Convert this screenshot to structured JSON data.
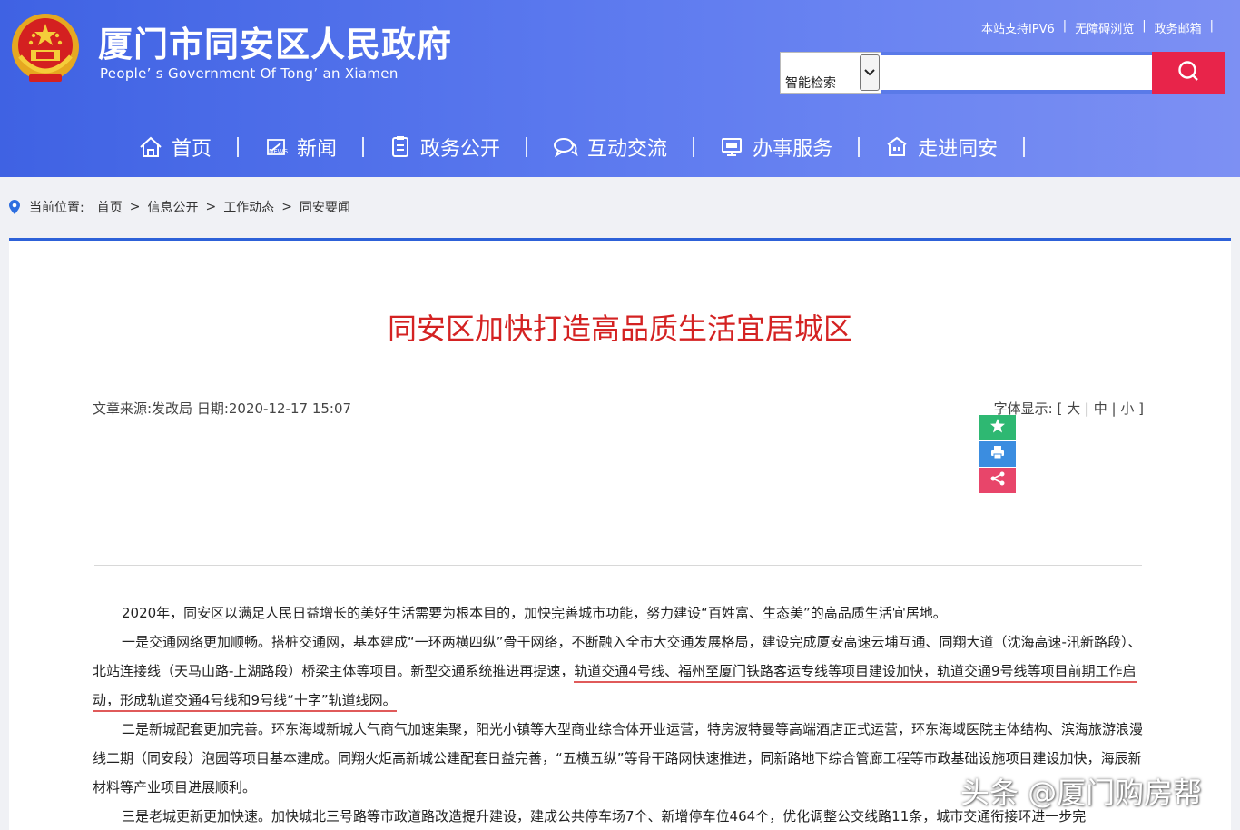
{
  "header": {
    "title": "厦门市同安区人民政府",
    "subtitle": "People’ s Government Of Tong’ an Xiamen",
    "top_links": [
      "本站支持IPV6",
      "无障碍浏览",
      "政务邮箱"
    ],
    "search": {
      "select_value": "智能检索",
      "placeholder": "",
      "button_icon": "search-icon"
    }
  },
  "nav": {
    "items": [
      {
        "label": "首页",
        "icon": "home-icon"
      },
      {
        "label": "新闻",
        "icon": "news-icon"
      },
      {
        "label": "政务公开",
        "icon": "document-icon"
      },
      {
        "label": "互动交流",
        "icon": "chat-icon"
      },
      {
        "label": "办事服务",
        "icon": "monitor-icon"
      },
      {
        "label": "走进同安",
        "icon": "building-icon"
      }
    ]
  },
  "breadcrumb": {
    "label": "当前位置:",
    "items": [
      "首页",
      "信息公开",
      "工作动态",
      "同安要闻"
    ]
  },
  "article": {
    "title": "同安区加快打造高品质生活宜居城区",
    "meta": "文章来源:发改局 日期:2020-12-17 15:07",
    "font_label": "字体显示:",
    "font_options": [
      "大",
      "中",
      "小"
    ],
    "tools": [
      "star-icon",
      "print-icon",
      "share-icon"
    ],
    "colors": {
      "star": "#2eb872",
      "print": "#3b8de0",
      "share": "#e8456a",
      "title": "#d42222"
    },
    "p1": "2020年，同安区以满足人民日益增长的美好生活需要为根本目的，加快完善城市功能，努力建设“百姓富、生态美”的高品质生活宜居地。",
    "p2_a": "一是交通网络更加顺畅。搭桩交通网，基本建成“一环两横四纵”骨干网络，不断融入全市大交通发展格局，建设完成厦安高速云埔互通、同翔大道（沈海高速-汛新路段）、北站连接线（天马山路-上湖路段）桥梁主体等项目。新型交通系统推进再提速，",
    "p2_b": "轨道交通4号线、福州至厦门铁路客运专线等项目建设加快，轨道交通9号线等项目前期工作启动，形成轨道交通4号线和9号线“十字”轨道线网。",
    "p3": "二是新城配套更加完善。环东海域新城人气商气加速集聚，阳光小镇等大型商业综合体开业运营，特房波特曼等高端酒店正式运营，环东海域医院主体结构、滨海旅游浪漫线二期（同安段）泡园等项目基本建成。同翔火炬高新城公建配套日益完善，“五横五纵”等骨干路网快速推进，同新路地下综合管廊工程等市政基础设施项目建设加快，海辰新材料等产业项目进展顺利。",
    "p4": "三是老城更新更加快速。加快城北三号路等市政道路改造提升建设，建成公共停车场7个、新增停车位464个，优化调整公交线路11条，城市交通衔接环进一步完"
  },
  "watermark": "头条 @厦门购房帮"
}
